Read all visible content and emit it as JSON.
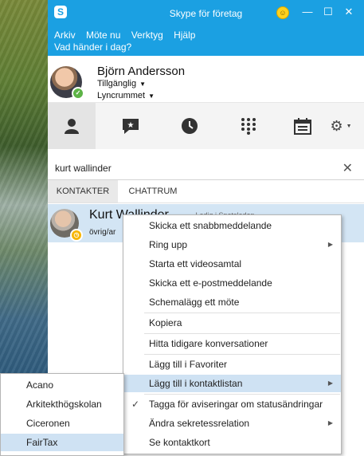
{
  "window": {
    "title": "Skype för företag"
  },
  "menu": {
    "items": [
      "Arkiv",
      "Möte nu",
      "Verktyg",
      "Hjälp"
    ]
  },
  "status_prompt": "Vad händer i dag?",
  "profile": {
    "name": "Björn Andersson",
    "availability": "Tillgänglig",
    "location": "Lyncrummet"
  },
  "nav_tabs": [
    {
      "icon": "contacts-icon"
    },
    {
      "icon": "conversations-icon"
    },
    {
      "icon": "history-icon"
    },
    {
      "icon": "dialpad-icon"
    },
    {
      "icon": "meetings-icon"
    },
    {
      "icon": "settings-icon"
    }
  ],
  "search": {
    "value": "kurt wallinder"
  },
  "subtabs": {
    "contacts": "KONTAKTER",
    "rooms": "CHATTRUM"
  },
  "contact": {
    "name": "Kurt Wallinder",
    "note": "- Ledig i Spetsleden",
    "group": "övrig/ar"
  },
  "context_menu": [
    {
      "label": "Skicka ett snabbmeddelande"
    },
    {
      "label": "Ring upp",
      "submenu": true
    },
    {
      "label": "Starta ett videosamtal"
    },
    {
      "label": "Skicka ett e-postmeddelande"
    },
    {
      "label": "Schemalägg ett möte"
    },
    {
      "label": "Kopiera"
    },
    {
      "label": "Hitta tidigare konversationer"
    },
    {
      "label": "Lägg till i Favoriter"
    },
    {
      "label": "Lägg till i kontaktlistan",
      "submenu": true,
      "active": true
    },
    {
      "label": "Tagga för aviseringar om statusändringar",
      "checked": true
    },
    {
      "label": "Ändra sekretessrelation",
      "submenu": true
    },
    {
      "label": "Se kontaktkort"
    }
  ],
  "submenu": [
    {
      "label": "Acano"
    },
    {
      "label": "Arkitekthögskolan"
    },
    {
      "label": "Ciceronen"
    },
    {
      "label": "FairTax",
      "active": true
    }
  ],
  "colors": {
    "brand": "#1ba0e2",
    "highlight": "#cfe2f3",
    "presence_available": "#5db346",
    "presence_away": "#f7b500"
  }
}
